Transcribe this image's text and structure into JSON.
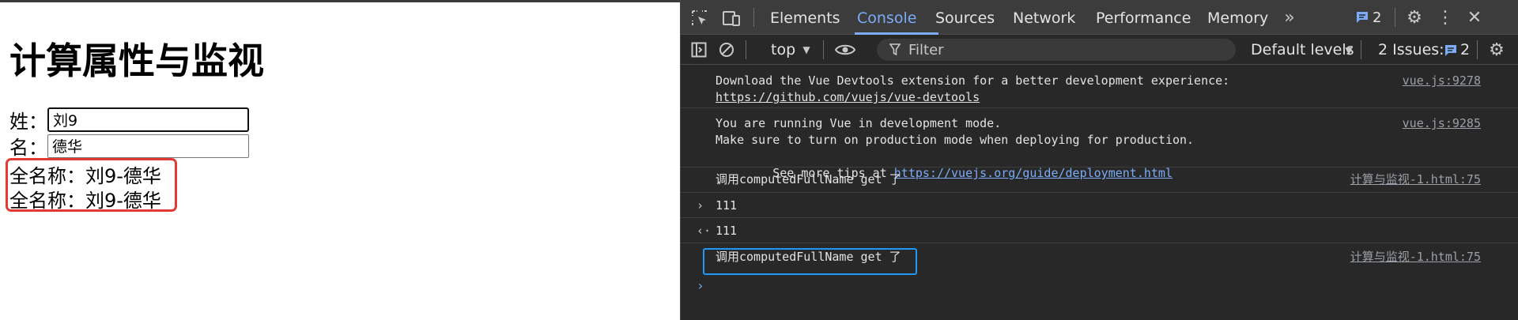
{
  "page": {
    "title": "计算属性与监视",
    "last_name_label": "姓：",
    "last_name_value": "刘9",
    "first_name_label": "名：",
    "first_name_value": "德华",
    "fullname_1": "全名称：刘9-德华",
    "fullname_2": "全名称：刘9-德华"
  },
  "devtools": {
    "tabs": [
      "Elements",
      "Console",
      "Sources",
      "Network",
      "Performance",
      "Memory"
    ],
    "active_tab": "Console",
    "issues_badge": "2",
    "toolbar": {
      "context": "top",
      "filter_placeholder": "Filter",
      "levels": "Default levels",
      "issues_label": "2 Issues:",
      "issues_count": "2"
    },
    "console": {
      "messages": [
        {
          "line1": "Download the Vue Devtools extension for a better development experience:",
          "link": "https://github.com/vuejs/vue-devtools",
          "source": "vue.js:9278"
        },
        {
          "line1": "You are running Vue in development mode.",
          "line2": "Make sure to turn on production mode when deploying for production.",
          "line3_prefix": "See more tips at ",
          "link": "https://vuejs.org/guide/deployment.html",
          "source": "vue.js:9285"
        },
        {
          "text": "调用computedFullName get 了",
          "source": "计算与监视-1.html:75"
        },
        {
          "text": "111"
        },
        {
          "text": "111"
        },
        {
          "text": "调用computedFullName get 了",
          "source": "计算与监视-1.html:75"
        }
      ]
    }
  }
}
